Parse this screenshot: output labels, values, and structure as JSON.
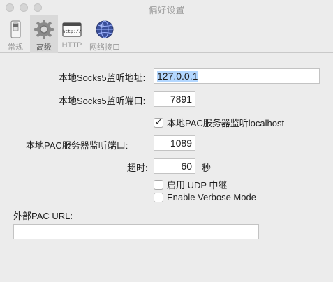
{
  "window": {
    "title": "偏好设置"
  },
  "toolbar": {
    "items": [
      {
        "label": "常规",
        "icon": "switch-icon"
      },
      {
        "label": "高级",
        "icon": "gear-icon"
      },
      {
        "label": "HTTP",
        "icon": "http-window-icon"
      },
      {
        "label": "网络接口",
        "icon": "network-globe-icon"
      }
    ],
    "selected": "高级"
  },
  "form": {
    "socks_address_label": "本地Socks5监听地址:",
    "socks_address_value": "127.0.0.1",
    "socks_port_label": "本地Socks5监听端口:",
    "socks_port_value": "7891",
    "pac_localhost_label": "本地PAC服务器监听localhost",
    "pac_localhost_checked": true,
    "pac_port_label": "本地PAC服务器监听端口:",
    "pac_port_value": "1089",
    "timeout_label": "超时:",
    "timeout_value": "60",
    "timeout_unit": "秒",
    "udp_relay_label": "启用 UDP 中继",
    "udp_relay_checked": false,
    "verbose_label": "Enable Verbose Mode",
    "verbose_checked": false,
    "external_pac_label": "外部PAC URL:",
    "external_pac_value": ""
  }
}
